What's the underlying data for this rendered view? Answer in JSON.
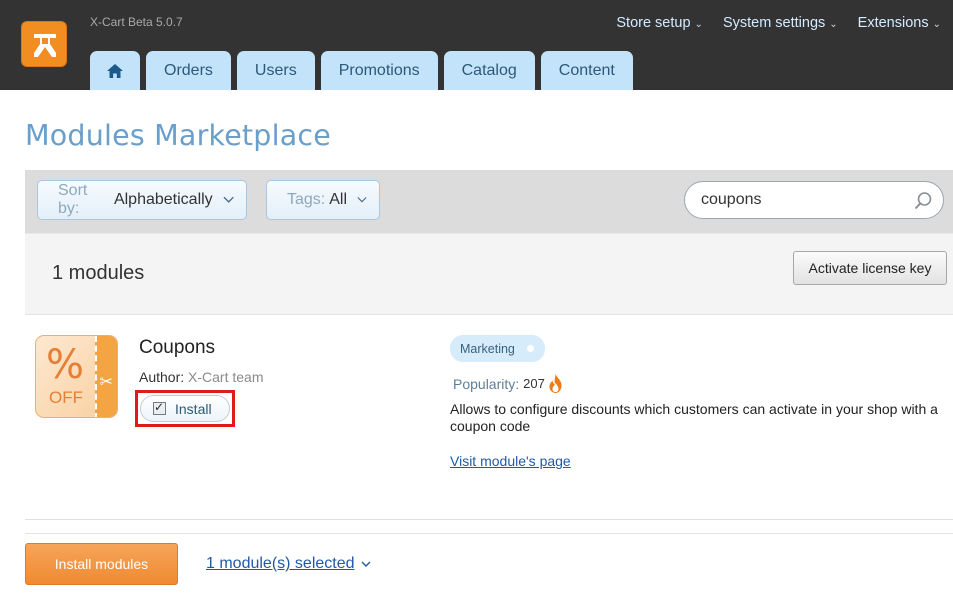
{
  "app": {
    "version": "X-Cart Beta 5.0.7"
  },
  "top_menu": [
    {
      "label": "Store setup"
    },
    {
      "label": "System settings"
    },
    {
      "label": "Extensions"
    }
  ],
  "tabs": [
    {
      "label": "Orders"
    },
    {
      "label": "Users"
    },
    {
      "label": "Promotions"
    },
    {
      "label": "Catalog"
    },
    {
      "label": "Content"
    }
  ],
  "page": {
    "title": "Modules Marketplace"
  },
  "filters": {
    "sort": {
      "label": "Sort by:",
      "value": "Alphabetically"
    },
    "tags": {
      "label": "Tags:",
      "value": "All"
    },
    "search": {
      "value": "coupons"
    }
  },
  "results": {
    "count_label": "1 modules",
    "activate_label": "Activate license key"
  },
  "module": {
    "icon_text": {
      "percent": "%",
      "off": "OFF"
    },
    "name": "Coupons",
    "author_label": "Author:",
    "author": "X-Cart team",
    "install_label": "Install",
    "install_checked": true,
    "tag": "Marketing",
    "popularity_label": "Popularity:",
    "popularity": "207",
    "description": "Allows to configure discounts which customers can activate in your shop with a coupon code",
    "link": "Visit module's page"
  },
  "footer": {
    "install_button": "Install modules",
    "selected_label": "1 module(s) selected"
  },
  "colors": {
    "header_bg": "#333333",
    "tab_bg": "#c3e3fb",
    "accent_orange": "#f28d21",
    "title_blue": "#6a9ecb",
    "highlight_red": "#e0191b"
  }
}
